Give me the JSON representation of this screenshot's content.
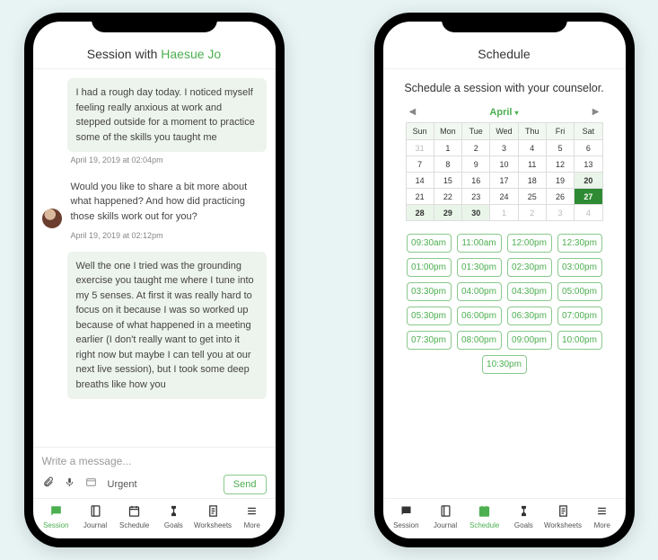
{
  "left": {
    "header_prefix": "Session with ",
    "header_name": "Haesue Jo",
    "messages": [
      {
        "text": "I had a rough day today. I noticed myself feeling really anxious at work and stepped outside for a moment to practice some of the skills you taught me",
        "ts": "April 19, 2019 at 02:04pm",
        "avatar": false,
        "bg": true
      },
      {
        "text": "Would you like to share a bit more about what happened? And how did practicing those skills work out for you?",
        "ts": "April 19, 2019 at 02:12pm",
        "avatar": true,
        "bg": false
      },
      {
        "text": "Well the one I tried was the grounding exercise you taught me where I tune into my 5 senses. At first it was really hard to focus on it because I was so worked up because of what happened in a meeting earlier (I don't really want to get into it right now but maybe I can tell you at our next live session), but I took some deep breaths like how you",
        "ts": "",
        "avatar": false,
        "bg": true
      }
    ],
    "composer_placeholder": "Write a message...",
    "urgent_label": "Urgent",
    "send_label": "Send"
  },
  "right": {
    "header": "Schedule",
    "title": "Schedule a session with your counselor.",
    "month": "April",
    "dow": [
      "Sun",
      "Mon",
      "Tue",
      "Wed",
      "Thu",
      "Fri",
      "Sat"
    ],
    "weeks": [
      [
        {
          "d": 31
        },
        {
          "d": 1,
          "in": true
        },
        {
          "d": 2,
          "in": true
        },
        {
          "d": 3,
          "in": true
        },
        {
          "d": 4,
          "in": true
        },
        {
          "d": 5,
          "in": true
        },
        {
          "d": 6,
          "in": true
        }
      ],
      [
        {
          "d": 7,
          "in": true
        },
        {
          "d": 8,
          "in": true
        },
        {
          "d": 9,
          "in": true
        },
        {
          "d": 10,
          "in": true
        },
        {
          "d": 11,
          "in": true
        },
        {
          "d": 12,
          "in": true
        },
        {
          "d": 13,
          "in": true
        }
      ],
      [
        {
          "d": 14,
          "in": true
        },
        {
          "d": 15,
          "in": true
        },
        {
          "d": 16,
          "in": true
        },
        {
          "d": 17,
          "in": true
        },
        {
          "d": 18,
          "in": true
        },
        {
          "d": 19,
          "in": true
        },
        {
          "d": 20,
          "in": true,
          "today": true
        }
      ],
      [
        {
          "d": 21,
          "in": true
        },
        {
          "d": 22,
          "in": true
        },
        {
          "d": 23,
          "in": true
        },
        {
          "d": 24,
          "in": true
        },
        {
          "d": 25,
          "in": true
        },
        {
          "d": 26,
          "in": true
        },
        {
          "d": 27,
          "in": true,
          "sel": true
        }
      ],
      [
        {
          "d": 28,
          "in": true,
          "today": true
        },
        {
          "d": 29,
          "in": true,
          "today": true
        },
        {
          "d": 30,
          "in": true,
          "today": true
        },
        {
          "d": 1
        },
        {
          "d": 2
        },
        {
          "d": 3
        },
        {
          "d": 4
        }
      ]
    ],
    "slots": [
      "09:30am",
      "11:00am",
      "12:00pm",
      "12:30pm",
      "01:00pm",
      "01:30pm",
      "02:30pm",
      "03:00pm",
      "03:30pm",
      "04:00pm",
      "04:30pm",
      "05:00pm",
      "05:30pm",
      "06:00pm",
      "06:30pm",
      "07:00pm",
      "07:30pm",
      "08:00pm",
      "09:00pm",
      "10:00pm",
      "10:30pm"
    ]
  },
  "tabs": [
    {
      "key": "session",
      "label": "Session"
    },
    {
      "key": "journal",
      "label": "Journal"
    },
    {
      "key": "schedule",
      "label": "Schedule"
    },
    {
      "key": "goals",
      "label": "Goals"
    },
    {
      "key": "worksheets",
      "label": "Worksheets"
    },
    {
      "key": "more",
      "label": "More"
    }
  ]
}
